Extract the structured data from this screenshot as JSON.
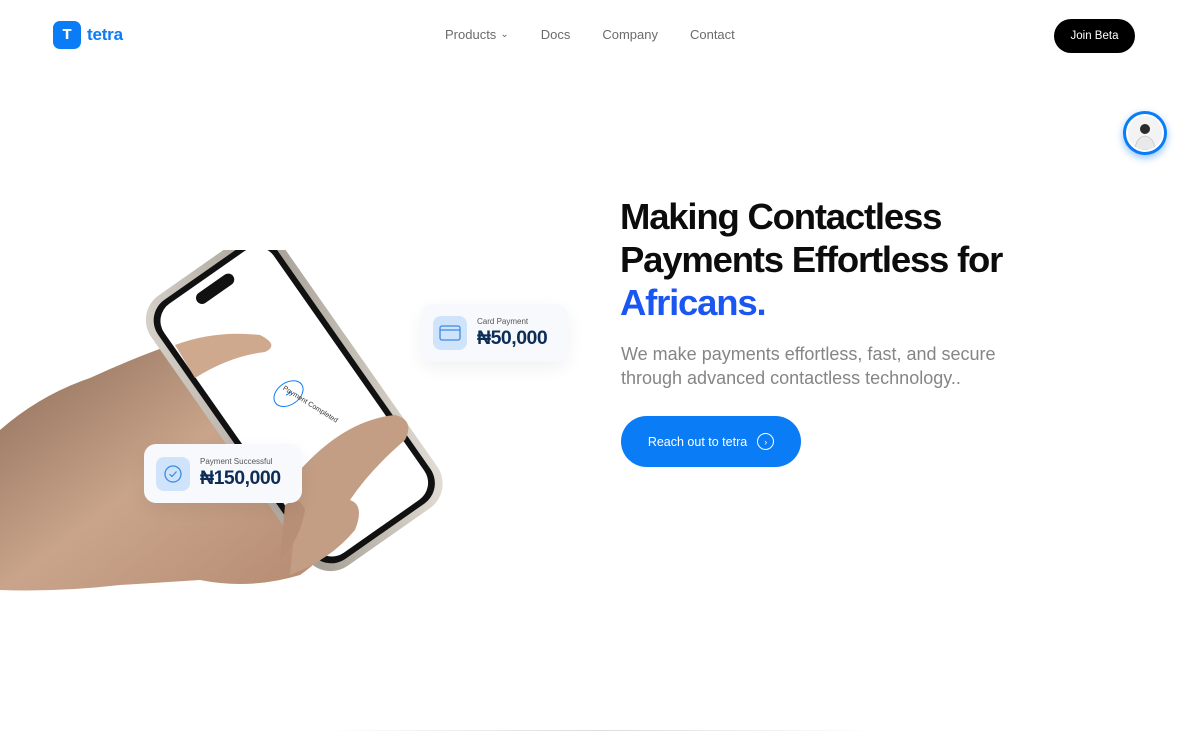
{
  "header": {
    "logo_letter": "T",
    "brand": "tetra",
    "nav": [
      {
        "label": "Products",
        "has_dropdown": true
      },
      {
        "label": "Docs"
      },
      {
        "label": "Company"
      },
      {
        "label": "Contact"
      }
    ],
    "join_label": "Join Beta"
  },
  "hero": {
    "title_line1": "Making Contactless",
    "title_line2": "Payments Effortless for",
    "title_highlight": "Africans.",
    "subtitle_line1": "We make payments effortless, fast, and secure",
    "subtitle_line2": "through advanced contactless technology..",
    "cta_label": "Reach out to tetra"
  },
  "illustration": {
    "phone_screen_text": "Payment Completed",
    "card_payment": {
      "label": "Card Payment",
      "amount": "₦50,000"
    },
    "payment_success": {
      "label": "Payment Successful",
      "amount": "₦150,000"
    }
  },
  "colors": {
    "brand_blue": "#0a7cf5",
    "highlight_blue": "#1a56f0",
    "button_black": "#000000"
  },
  "icons": [
    "chevron-down-icon",
    "arrow-circle-right-icon",
    "card-icon",
    "check-circle-icon",
    "chat-avatar-icon"
  ]
}
